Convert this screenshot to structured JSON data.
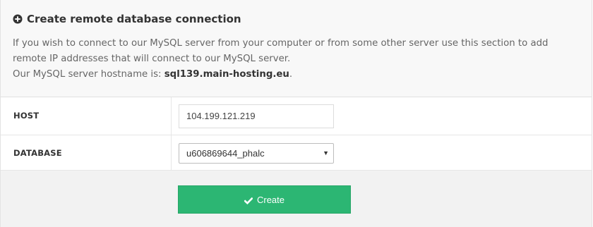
{
  "panel": {
    "title": "Create remote database connection",
    "title_icon": "plus-circle-icon",
    "description": "If you wish to connect to our MySQL server from your computer or from some other server use this section to add remote IP addresses that will connect to our MySQL server.",
    "hostname_prefix": "Our MySQL server hostname is: ",
    "hostname": "sql139.main-hosting.eu",
    "hostname_suffix": "."
  },
  "form": {
    "host_label": "HOST",
    "host_value": "104.199.121.219",
    "database_label": "DATABASE",
    "database_selected": "u606869644_phalc"
  },
  "actions": {
    "create_label": "Create",
    "create_icon": "check-icon",
    "accent_color": "#2cb673"
  }
}
